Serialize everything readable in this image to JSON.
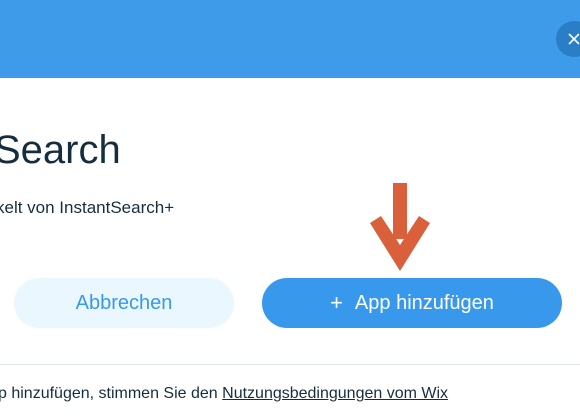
{
  "dialog": {
    "title": "Search",
    "subtitle": "kelt von InstantSearch+",
    "close_icon": "close-icon",
    "arrow_color": "#d9603b",
    "header_color": "#3d9be9"
  },
  "buttons": {
    "cancel_label": "Abbrechen",
    "add_icon": "+",
    "add_label": "App hinzufügen"
  },
  "footer": {
    "text": "p hinzufügen, stimmen Sie den ",
    "link": "Nutzungsbedingungen vom Wix"
  }
}
